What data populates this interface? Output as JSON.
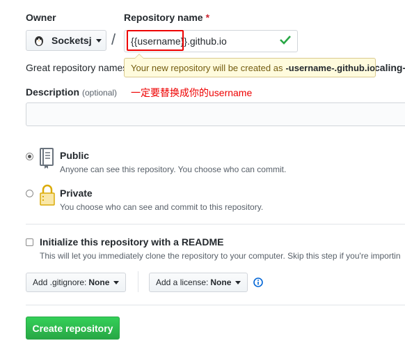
{
  "owner": {
    "label": "Owner",
    "selected": "Socketsj"
  },
  "repo": {
    "label": "Repository name",
    "required_mark": "*",
    "slash": "/",
    "value_highlight": "{{username}}",
    "value_suffix": ".github.io"
  },
  "tooltip": {
    "text": "Your new repository will be created as",
    "name": "-username-.github.io"
  },
  "hint": {
    "left": "Great repository names",
    "right": "caling-"
  },
  "description": {
    "label": "Description",
    "optional": "(optional)"
  },
  "annotation": "一定要替换成你的username",
  "visibility": {
    "public": {
      "title": "Public",
      "note": "Anyone can see this repository. You choose who can commit."
    },
    "private": {
      "title": "Private",
      "note": "You choose who can see and commit to this repository."
    }
  },
  "init": {
    "title": "Initialize this repository with a README",
    "note": "This will let you immediately clone the repository to your computer. Skip this step if you're importin"
  },
  "gitignore": {
    "label": "Add .gitignore:",
    "value": "None"
  },
  "license": {
    "label": "Add a license:",
    "value": "None"
  },
  "create_button": "Create repository",
  "colors": {
    "create": "#28a745",
    "annotation": "#e00000",
    "info": "#0366d6"
  }
}
